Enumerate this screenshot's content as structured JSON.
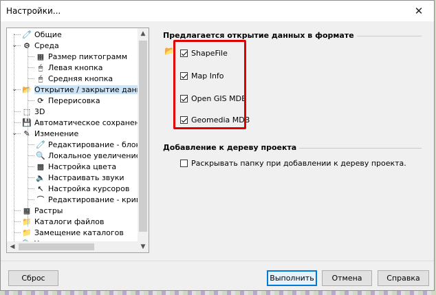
{
  "window": {
    "title": "Настройки..."
  },
  "tree": {
    "items": [
      {
        "label": "Общие",
        "icon": "pin-icon",
        "glyph": "🧷",
        "level": 1,
        "expander": ""
      },
      {
        "label": "Среда",
        "icon": "settings-icon",
        "glyph": "⚙",
        "level": 1,
        "expander": "⌄"
      },
      {
        "label": "Размер пиктограмм",
        "icon": "ruler-icon",
        "glyph": "▦",
        "level": 2,
        "expander": ""
      },
      {
        "label": "Левая кнопка",
        "icon": "mouse-left-icon",
        "glyph": "🖱",
        "level": 2,
        "expander": ""
      },
      {
        "label": "Средняя кнопка",
        "icon": "mouse-middle-icon",
        "glyph": "🖱",
        "level": 2,
        "expander": ""
      },
      {
        "label": "Открытие / закрытие данных",
        "icon": "folder-open-icon",
        "glyph": "📂",
        "level": 1,
        "expander": "⌄",
        "selected": true
      },
      {
        "label": "Перерисовка",
        "icon": "redraw-icon",
        "glyph": "⟳",
        "level": 2,
        "expander": ""
      },
      {
        "label": "3D",
        "icon": "cube-icon",
        "glyph": "⬚",
        "level": 1,
        "expander": ""
      },
      {
        "label": "Автоматическое сохранение",
        "icon": "save-icon",
        "glyph": "💾",
        "level": 1,
        "expander": ""
      },
      {
        "label": "Изменение",
        "icon": "edit-icon",
        "glyph": "✎",
        "level": 1,
        "expander": "⌄"
      },
      {
        "label": "Редактирование - блокировка",
        "icon": "pin-edit-icon",
        "glyph": "🧷",
        "level": 2,
        "expander": ""
      },
      {
        "label": "Локальное увеличение - лупа",
        "icon": "magnifier-icon",
        "glyph": "🔍",
        "level": 2,
        "expander": ""
      },
      {
        "label": "Настройка цвета",
        "icon": "palette-icon",
        "glyph": "▩",
        "level": 2,
        "expander": ""
      },
      {
        "label": "Настраивать звуки",
        "icon": "speaker-icon",
        "glyph": "🔈",
        "level": 2,
        "expander": ""
      },
      {
        "label": "Настройка курсоров",
        "icon": "cursor-icon",
        "glyph": "↖",
        "level": 2,
        "expander": ""
      },
      {
        "label": "Редактирование - кривые",
        "icon": "curve-icon",
        "glyph": "⌒",
        "level": 2,
        "expander": ""
      },
      {
        "label": "Растры",
        "icon": "raster-icon",
        "glyph": "▦",
        "level": 1,
        "expander": ""
      },
      {
        "label": "Каталоги файлов",
        "icon": "folder-icon",
        "glyph": "📁",
        "level": 1,
        "expander": ""
      },
      {
        "label": "Замещение каталогов",
        "icon": "folder-replace-icon",
        "glyph": "📁",
        "level": 1,
        "expander": ""
      },
      {
        "label": "Увеличение от колесика",
        "icon": "zoom-icon",
        "glyph": "🔍",
        "level": 1,
        "expander": ""
      }
    ]
  },
  "formats_group": {
    "title": "Предлагается открытие данных в формате",
    "options": [
      {
        "label": "ShapeFile",
        "checked": true
      },
      {
        "label": "Map Info",
        "checked": true
      },
      {
        "label": "Open GIS MDB",
        "checked": true
      },
      {
        "label": "Geomedia MDB",
        "checked": true
      }
    ]
  },
  "project_group": {
    "title": "Добавление к дереву проекта",
    "option": {
      "label": "Раскрывать папку при добавлении к дереву проекта.",
      "checked": false
    }
  },
  "buttons": {
    "reset": "Сброс",
    "ok": "Выполнить",
    "cancel": "Отмена",
    "help": "Справка"
  },
  "colors": {
    "accent": "#0078d7",
    "highlight": "#e00000",
    "selection": "#cce4f7"
  }
}
